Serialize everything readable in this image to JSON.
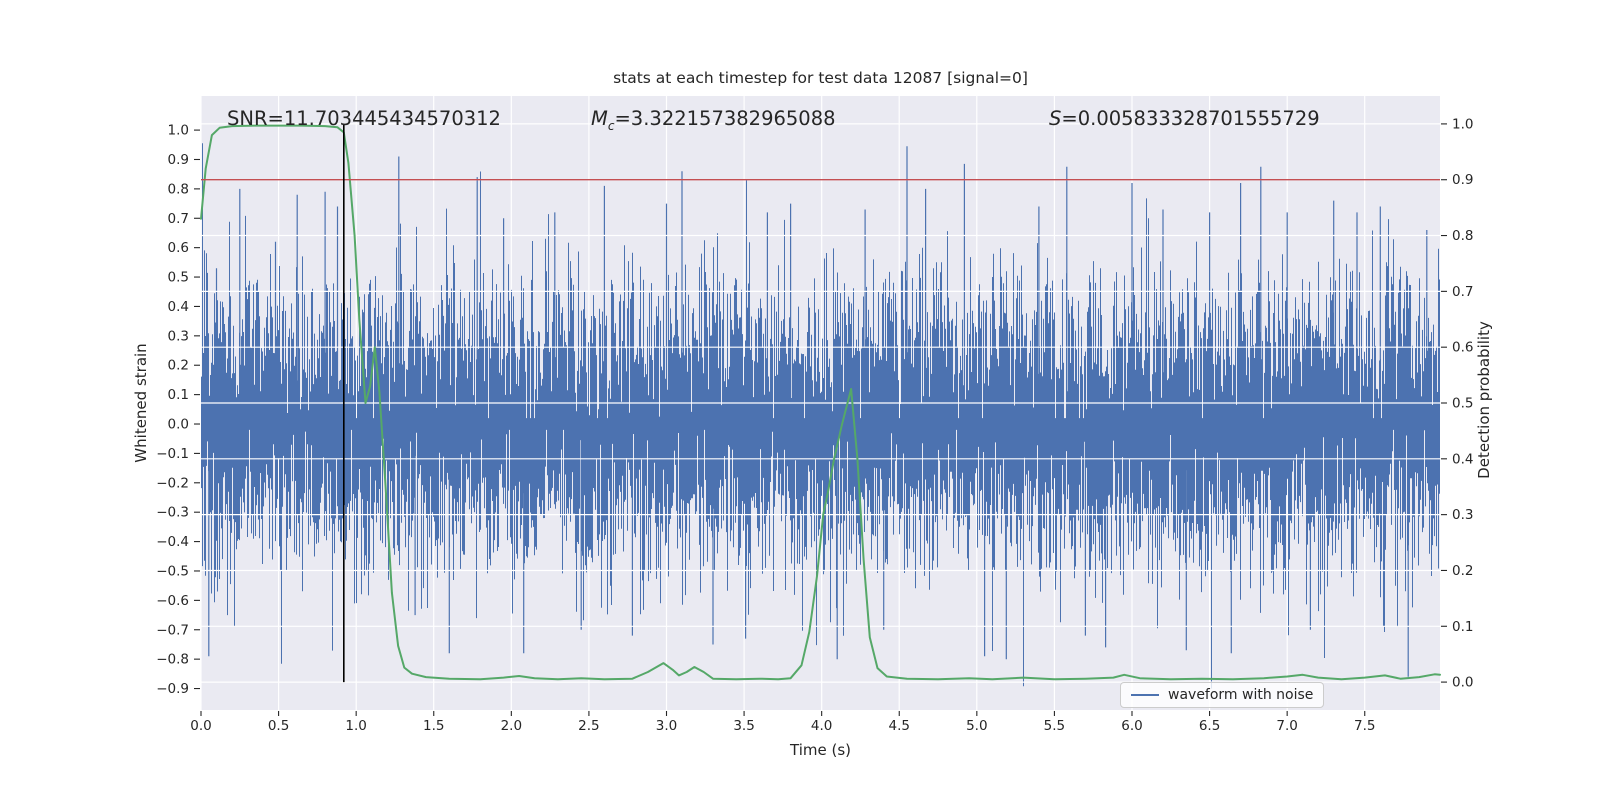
{
  "figure": {
    "title": "stats at each timestep for test data 12087 [signal=0]",
    "annotations": {
      "snr": "SNR=11.703445434570312",
      "mc_prefix": "M",
      "mc_sub": "c",
      "mc_value": "=3.322157382965088",
      "s_prefix": "S",
      "s_value": "=0.005833328701555729"
    },
    "xlabel": "Time (s)",
    "ylabel_left": "Whitened strain",
    "ylabel_right": "Detection probability",
    "legend": {
      "label": "waveform with noise"
    }
  },
  "colors": {
    "axes_bg": "#eaeaf2",
    "grid": "#ffffff",
    "waveform": "#4c72b0",
    "probability": "#55a868",
    "threshold": "#c44e52",
    "marker": "#000000",
    "text": "#262626",
    "legend_border": "#cccccc"
  },
  "chart_data": {
    "type": "line",
    "title": "stats at each timestep for test data 12087 [signal=0]",
    "xlabel": "Time (s)",
    "ylabel_left": "Whitened strain",
    "ylabel_right": "Detection probability",
    "x_range": [
      0,
      7.985
    ],
    "y_left_range": [
      -0.973,
      1.116
    ],
    "y_right_range": [
      -0.05,
      1.05
    ],
    "x_tick_values": [
      0,
      0.5,
      1,
      1.5,
      2,
      2.5,
      3,
      3.5,
      4,
      4.5,
      5,
      5.5,
      6,
      6.5,
      7,
      7.5
    ],
    "x_tick_labels": [
      "0.0",
      "0.5",
      "1.0",
      "1.5",
      "2.0",
      "2.5",
      "3.0",
      "3.5",
      "4.0",
      "4.5",
      "5.0",
      "5.5",
      "6.0",
      "6.5",
      "7.0",
      "7.5"
    ],
    "y_left_tick_values": [
      1.0,
      0.9,
      0.8,
      0.7,
      0.6,
      0.5,
      0.4,
      0.3,
      0.2,
      0.1,
      0.0,
      -0.1,
      -0.2,
      -0.3,
      -0.4,
      -0.5,
      -0.6,
      -0.7,
      -0.8,
      -0.9
    ],
    "y_left_tick_labels": [
      "1.0",
      "0.9",
      "0.8",
      "0.7",
      "0.6",
      "0.5",
      "0.4",
      "0.3",
      "0.2",
      "0.1",
      "0.0",
      "−0.1",
      "−0.2",
      "−0.3",
      "−0.4",
      "−0.5",
      "−0.6",
      "−0.7",
      "−0.8",
      "−0.9"
    ],
    "y_right_tick_values": [
      1.0,
      0.9,
      0.8,
      0.7,
      0.6,
      0.5,
      0.4,
      0.3,
      0.2,
      0.1,
      0.0
    ],
    "y_right_tick_labels": [
      "1.0",
      "0.9",
      "0.8",
      "0.7",
      "0.6",
      "0.5",
      "0.4",
      "0.3",
      "0.2",
      "0.1",
      "0.0"
    ],
    "grid": {
      "horizontal_on_axis": "right",
      "vertical_on_axis": "x",
      "color": "#ffffff"
    },
    "legend": {
      "position": "lower right",
      "entries": [
        "waveform with noise"
      ]
    },
    "series": [
      {
        "name": "waveform with noise",
        "kind": "noise",
        "axis": "left",
        "color": "#4c72b0",
        "sigma": 0.235,
        "samples_per_column": 7,
        "seed": 12087,
        "clip": [
          -0.9,
          0.97
        ],
        "extremes": [
          [
            0.05,
            -0.79
          ],
          [
            0.1,
            0.53
          ],
          [
            0.25,
            0.8
          ],
          [
            0.48,
            0.62
          ],
          [
            0.62,
            0.78
          ],
          [
            0.8,
            0.79
          ],
          [
            0.88,
            0.74
          ],
          [
            1.275,
            0.91
          ],
          [
            1.38,
            -0.65
          ],
          [
            1.6,
            -0.78
          ],
          [
            1.78,
            0.84
          ],
          [
            1.95,
            0.7
          ],
          [
            2.08,
            -0.78
          ],
          [
            2.28,
            0.72
          ],
          [
            2.45,
            -0.7
          ],
          [
            2.6,
            0.81
          ],
          [
            2.78,
            -0.72
          ],
          [
            3.0,
            0.75
          ],
          [
            3.1,
            0.86
          ],
          [
            3.3,
            -0.75
          ],
          [
            3.51,
            -0.73
          ],
          [
            3.65,
            0.72
          ],
          [
            3.8,
            0.75
          ],
          [
            4.1,
            -0.8
          ],
          [
            4.28,
            0.73
          ],
          [
            4.4,
            -0.7
          ],
          [
            4.55,
            0.945
          ],
          [
            4.67,
            0.8
          ],
          [
            4.92,
            0.885
          ],
          [
            5.05,
            -0.79
          ],
          [
            5.19,
            -0.8
          ],
          [
            5.4,
            0.74
          ],
          [
            5.58,
            0.875
          ],
          [
            5.7,
            -0.72
          ],
          [
            5.83,
            -0.76
          ],
          [
            6.0,
            0.82
          ],
          [
            6.2,
            0.73
          ],
          [
            6.35,
            -0.77
          ],
          [
            6.5,
            0.72
          ],
          [
            6.64,
            -0.78
          ],
          [
            6.7,
            0.82
          ],
          [
            6.83,
            0.875
          ],
          [
            7.0,
            0.72
          ],
          [
            7.15,
            -0.7
          ],
          [
            7.3,
            0.76
          ],
          [
            7.45,
            0.72
          ],
          [
            7.6,
            0.74
          ],
          [
            7.78,
            -0.86
          ],
          [
            7.9,
            0.66
          ]
        ]
      },
      {
        "name": "detection probability",
        "kind": "line",
        "axis": "right",
        "color": "#55a868",
        "points": [
          [
            0,
            0.83
          ],
          [
            0.03,
            0.92
          ],
          [
            0.07,
            0.98
          ],
          [
            0.12,
            0.993
          ],
          [
            0.2,
            0.996
          ],
          [
            0.35,
            0.997
          ],
          [
            0.5,
            0.997
          ],
          [
            0.65,
            0.997
          ],
          [
            0.8,
            0.996
          ],
          [
            0.88,
            0.994
          ],
          [
            0.92,
            0.985
          ],
          [
            0.95,
            0.93
          ],
          [
            0.99,
            0.8
          ],
          [
            1.02,
            0.65
          ],
          [
            1.06,
            0.5
          ],
          [
            1.09,
            0.53
          ],
          [
            1.12,
            0.6
          ],
          [
            1.15,
            0.52
          ],
          [
            1.19,
            0.35
          ],
          [
            1.23,
            0.16
          ],
          [
            1.27,
            0.065
          ],
          [
            1.31,
            0.026
          ],
          [
            1.36,
            0.015
          ],
          [
            1.45,
            0.009
          ],
          [
            1.6,
            0.006
          ],
          [
            1.8,
            0.005
          ],
          [
            1.95,
            0.008
          ],
          [
            2.05,
            0.011
          ],
          [
            2.15,
            0.007
          ],
          [
            2.3,
            0.005
          ],
          [
            2.45,
            0.007
          ],
          [
            2.6,
            0.005
          ],
          [
            2.78,
            0.006
          ],
          [
            2.88,
            0.018
          ],
          [
            2.98,
            0.034
          ],
          [
            3.04,
            0.022
          ],
          [
            3.08,
            0.012
          ],
          [
            3.13,
            0.018
          ],
          [
            3.18,
            0.027
          ],
          [
            3.24,
            0.018
          ],
          [
            3.3,
            0.006
          ],
          [
            3.45,
            0.005
          ],
          [
            3.6,
            0.006
          ],
          [
            3.72,
            0.005
          ],
          [
            3.8,
            0.007
          ],
          [
            3.87,
            0.03
          ],
          [
            3.92,
            0.09
          ],
          [
            3.97,
            0.19
          ],
          [
            4.01,
            0.3
          ],
          [
            4.04,
            0.34
          ],
          [
            4.08,
            0.4
          ],
          [
            4.13,
            0.46
          ],
          [
            4.19,
            0.525
          ],
          [
            4.23,
            0.4
          ],
          [
            4.27,
            0.22
          ],
          [
            4.31,
            0.08
          ],
          [
            4.36,
            0.025
          ],
          [
            4.42,
            0.01
          ],
          [
            4.55,
            0.006
          ],
          [
            4.75,
            0.005
          ],
          [
            4.95,
            0.007
          ],
          [
            5.1,
            0.005
          ],
          [
            5.3,
            0.008
          ],
          [
            5.5,
            0.005
          ],
          [
            5.7,
            0.006
          ],
          [
            5.88,
            0.008
          ],
          [
            5.95,
            0.013
          ],
          [
            6.05,
            0.007
          ],
          [
            6.25,
            0.005
          ],
          [
            6.45,
            0.006
          ],
          [
            6.65,
            0.005
          ],
          [
            6.85,
            0.007
          ],
          [
            7.0,
            0.01
          ],
          [
            7.1,
            0.013
          ],
          [
            7.2,
            0.008
          ],
          [
            7.35,
            0.005
          ],
          [
            7.5,
            0.008
          ],
          [
            7.63,
            0.012
          ],
          [
            7.73,
            0.006
          ],
          [
            7.85,
            0.009
          ],
          [
            7.95,
            0.014
          ],
          [
            7.985,
            0.013
          ]
        ]
      },
      {
        "name": "detection threshold",
        "kind": "hline",
        "axis": "right",
        "color": "#c44e52",
        "y": 0.9
      },
      {
        "name": "event time marker",
        "kind": "vline",
        "axis": "right",
        "color": "#000000",
        "x": 0.92,
        "y_span": [
          0.0,
          1.0
        ]
      }
    ]
  }
}
